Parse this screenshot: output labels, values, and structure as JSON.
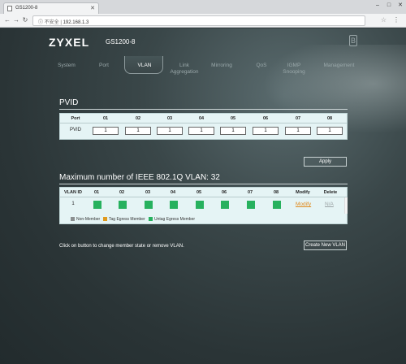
{
  "browser": {
    "tab_title": "GS1200-8",
    "security_label": "不安全",
    "url": "192.168.1.3"
  },
  "header": {
    "logo": "ZYXEL",
    "model": "GS1200-8",
    "b_glyph": "B"
  },
  "nav": {
    "items": [
      {
        "label": "System"
      },
      {
        "label": "Port"
      },
      {
        "label": "VLAN"
      },
      {
        "label": "Link\nAggregation"
      },
      {
        "label": "Mirroring"
      },
      {
        "label": "QoS"
      },
      {
        "label": "IGMP\nSnooping"
      },
      {
        "label": "Management"
      }
    ],
    "active": "VLAN"
  },
  "pvid": {
    "title": "PVID",
    "port_header": "Port",
    "row_label": "PVID",
    "ports": [
      "01",
      "02",
      "03",
      "04",
      "05",
      "06",
      "07",
      "08"
    ],
    "values": [
      "1",
      "1",
      "1",
      "1",
      "1",
      "1",
      "1",
      "1"
    ],
    "apply_label": "Apply"
  },
  "vlan": {
    "title": "Maximum number of IEEE 802.1Q VLAN: 32",
    "col_id": "VLAN ID",
    "ports": [
      "01",
      "02",
      "03",
      "04",
      "05",
      "06",
      "07",
      "08"
    ],
    "col_modify": "Modify",
    "col_delete": "Delete",
    "rows": [
      {
        "id": "1",
        "modify": "Modify",
        "delete": "N/A"
      }
    ],
    "legend": {
      "non_member": "Non-Member",
      "tag_egress": "Tag Egress Member",
      "untag_egress": "Untag Egress Member"
    },
    "colors": {
      "non_member": "#8a8f90",
      "tag_egress": "#e09a1e",
      "untag_egress": "#27b15e"
    },
    "hint": "Click on button to change member state or remove VLAN.",
    "create_label": "Create New VLAN"
  }
}
